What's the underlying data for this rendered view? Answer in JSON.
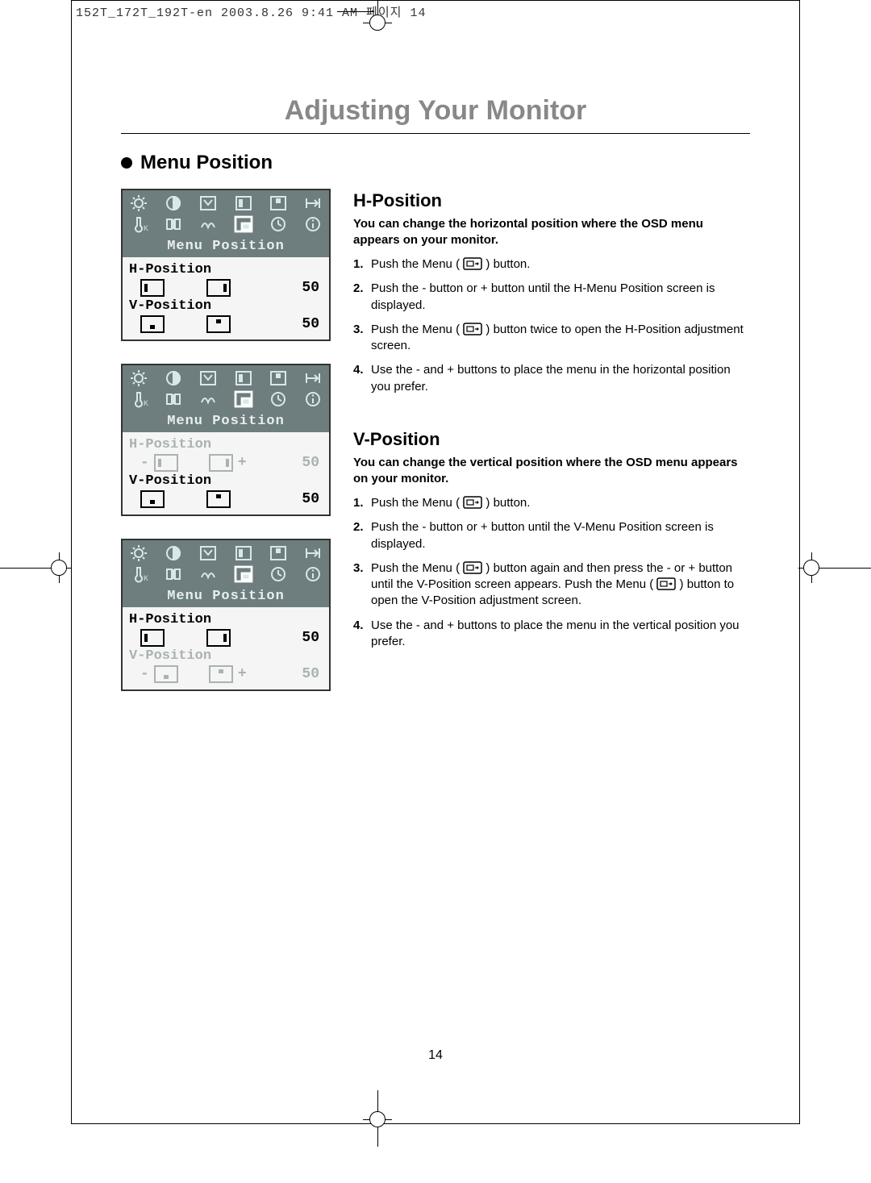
{
  "crop_header": "152T_172T_192T-en  2003.8.26 9:41 AM  페이지 14",
  "page_title": "Adjusting Your Monitor",
  "section_title": "Menu Position",
  "osd": {
    "label": "Menu Position",
    "h_label": "H-Position",
    "v_label": "V-Position",
    "h_value": "50",
    "v_value": "50",
    "minus": "-",
    "plus": "+"
  },
  "h_section": {
    "title": "H-Position",
    "desc": "You can change the horizontal position where the OSD menu appears on your monitor.",
    "steps": [
      "Push the Menu (        ) button.",
      "Push the - button or + button until the H-Menu Position screen is displayed.",
      "Push the Menu (        ) button twice to open the H-Position adjustment screen.",
      "Use the - and + buttons to place the menu in the horizontal position you prefer."
    ]
  },
  "v_section": {
    "title": "V-Position",
    "desc": "You can change the vertical position where the OSD menu appears on your monitor.",
    "steps": [
      "Push the Menu (        ) button.",
      "Push the - button or + button until the V-Menu Position screen is displayed.",
      "Push the Menu (        ) button again and then press the - or + button until the V-Position screen appears. Push the Menu (        ) button to open the V-Position adjustment screen.",
      "Use the - and + buttons to place the menu in the vertical position you prefer."
    ]
  },
  "page_number": "14"
}
